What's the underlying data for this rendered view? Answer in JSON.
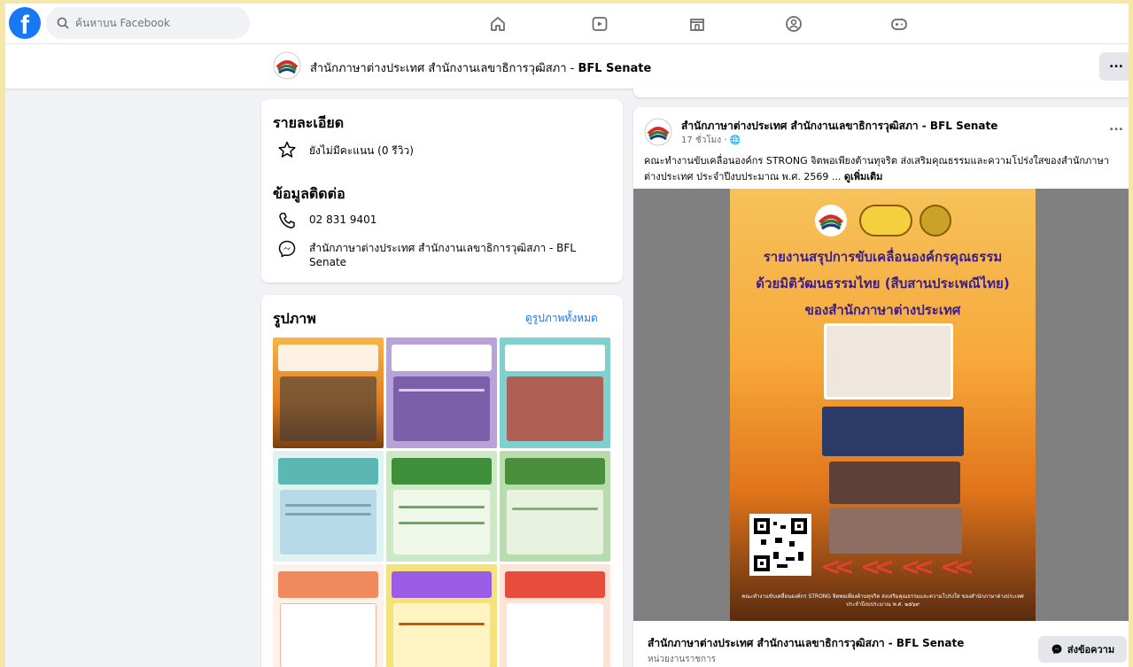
{
  "search": {
    "placeholder": "ค้นหาบน Facebook"
  },
  "nav": {
    "icons": [
      "home-icon",
      "video-icon",
      "marketplace-icon",
      "groups-icon",
      "gaming-icon"
    ]
  },
  "page": {
    "name_thai": "สำนักภาษาต่างประเทศ สำนักงานเลขาธิการวุฒิสภา - ",
    "name_en": "BFL Senate",
    "more_label": "..."
  },
  "details": {
    "title": "รายละเอียด",
    "rating": "ยังไม่มีคะแนน (0 รีวิว)",
    "contact_title": "ข้อมูลติดต่อ",
    "phone": "02 831 9401",
    "messenger": "สำนักภาษาต่างประเทศ สำนักงานเลขาธิการวุฒิสภา - BFL Senate"
  },
  "photos": {
    "title": "รูปภาพ",
    "see_all": "ดูรูปภาพทั้งหมด"
  },
  "post": {
    "author": "สำนักภาษาต่างประเทศ สำนักงานเลขาธิการวุฒิสภา - BFL Senate",
    "time": "17 ชั่วโมง · 🌐",
    "text": "คณะทำงานขับเคลื่อนองค์กร STRONG จิตพอเพียงต้านทุจริต ส่งเสริมคุณธรรมและความโปร่งใสของสำนักภาษาต่างประเทศ ประจำปีงบประมาณ พ.ศ. 2569 ... ",
    "see_more": "ดูเพิ่มเติม",
    "more": "...",
    "poster_title_1": "รายงานสรุปการขับเคลื่อนองค์กรคุณธรรม",
    "poster_title_2": "ด้วยมิติวัฒนธรรมไทย (สืบสานประเพณีไทย)",
    "poster_title_3": "ของสำนักภาษาต่างประเทศ",
    "poster_footer": "คณะทำงานขับเคลื่อนองค์กร STRONG จิตพอเพียงต้านทุจริต ส่งเสริมคุณธรรมและความโปร่งใส ของสำนักภาษาต่างประเทศ ประจำปีงบประมาณ พ.ศ. ๒๕๖๙",
    "footer_title": "สำนักภาษาต่างประเทศ สำนักงานเลขาธิการวุฒิสภา - BFL Senate",
    "footer_sub": "หน่วยงานราชการ",
    "message_button": "ส่งข้อความ"
  },
  "colors": {
    "accent": "#1877f2",
    "background": "#f0f2f5",
    "outer": "#f5e7a8"
  }
}
